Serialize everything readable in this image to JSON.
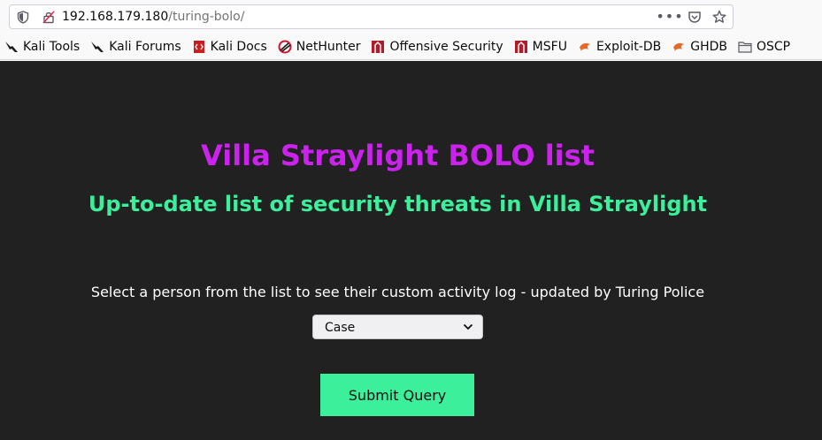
{
  "browser": {
    "url_host": "192.168.179.180",
    "url_path": "/turing-bolo/",
    "actions": [
      "more-icon",
      "pocket-icon",
      "star-icon"
    ]
  },
  "bookmarks": [
    {
      "label": "Kali Tools",
      "icon": "kali-dragon-icon"
    },
    {
      "label": "Kali Forums",
      "icon": "kali-dragon-icon"
    },
    {
      "label": "Kali Docs",
      "icon": "kali-docs-icon"
    },
    {
      "label": "NetHunter",
      "icon": "nethunter-icon"
    },
    {
      "label": "Offensive Security",
      "icon": "offsec-icon"
    },
    {
      "label": "MSFU",
      "icon": "offsec-icon"
    },
    {
      "label": "Exploit-DB",
      "icon": "exploitdb-icon"
    },
    {
      "label": "GHDB",
      "icon": "exploitdb-icon"
    },
    {
      "label": "OSCP",
      "icon": "folder-icon"
    }
  ],
  "page": {
    "title": "Villa Straylight BOLO list",
    "subtitle": "Up-to-date list of security threats in Villa Straylight",
    "prompt": "Select a person from the list to see their custom activity log - updated by Turing Police",
    "select_value": "Case",
    "submit_label": "Submit Query"
  },
  "colors": {
    "title": "#cc22ee",
    "subtitle": "#3cef9a",
    "background": "#212121",
    "button": "#3cef9a"
  }
}
